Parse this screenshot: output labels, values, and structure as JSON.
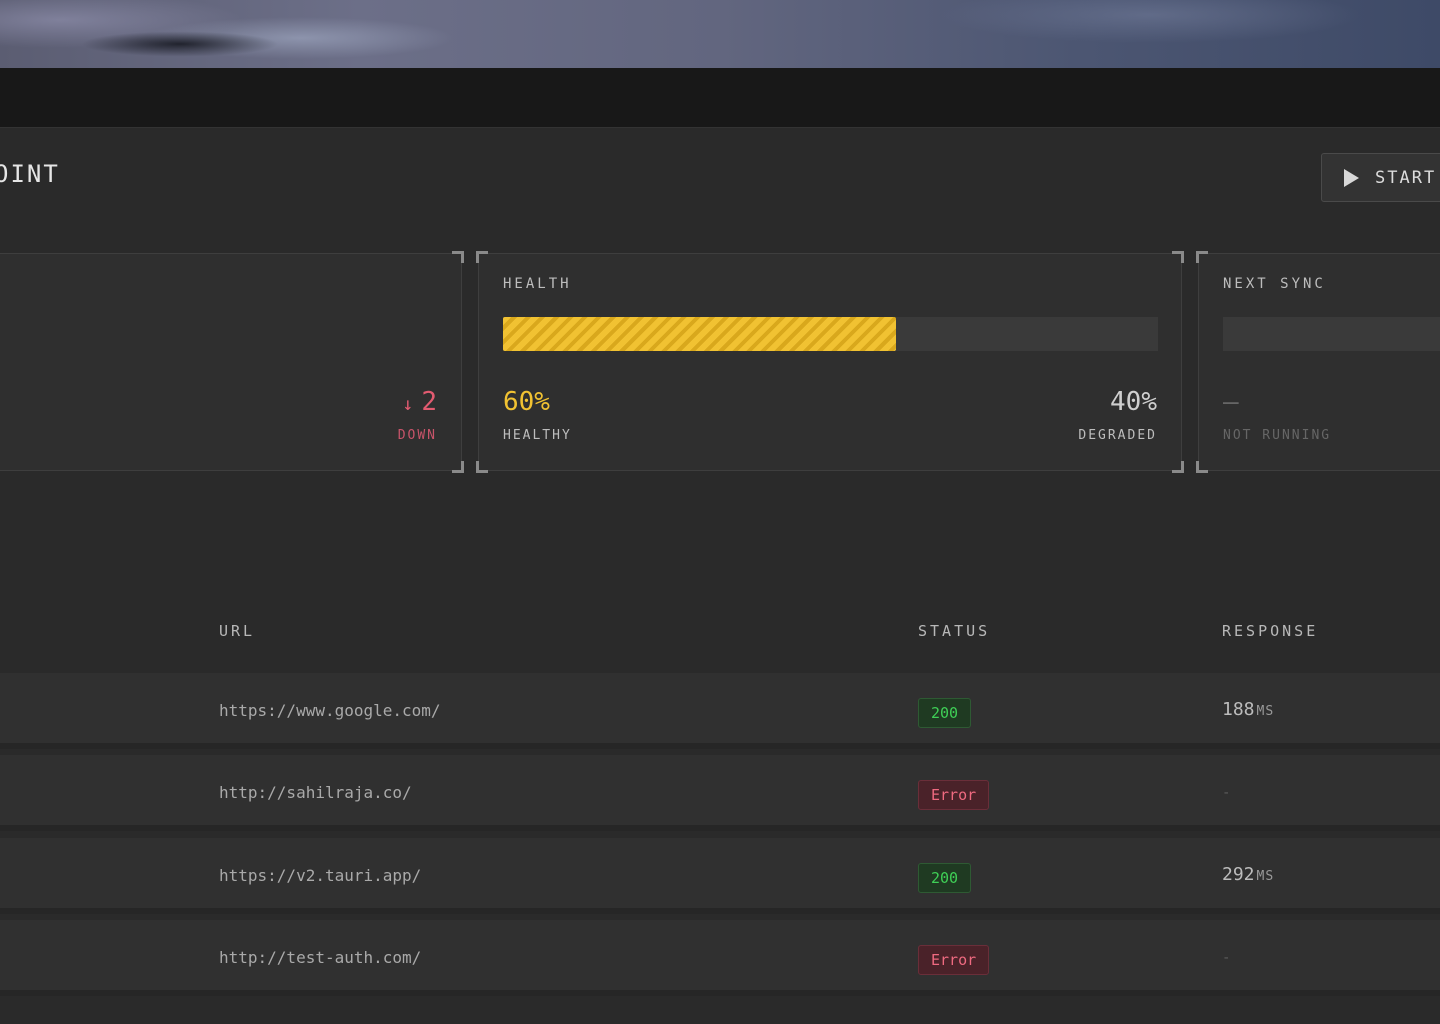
{
  "page": {
    "heading": "OINT"
  },
  "toolbar": {
    "start_label": "START"
  },
  "stats": {
    "down": {
      "value": "2",
      "arrow": "↓",
      "caption": "DOWN"
    },
    "health": {
      "label": "HEALTH",
      "healthy_fraction": 0.6,
      "healthy_value": "60%",
      "healthy_caption": "HEALTHY",
      "degraded_value": "40%",
      "degraded_caption": "DEGRADED",
      "fill_color": "#f1c232"
    },
    "next_sync": {
      "label": "NEXT SYNC",
      "value": "—",
      "caption": "NOT RUNNING"
    }
  },
  "table": {
    "headers": {
      "url": "URL",
      "status": "STATUS",
      "response": "RESPONSE"
    },
    "rows": [
      {
        "url": "https://www.google.com/",
        "status": "200",
        "status_kind": "ok",
        "response": "188",
        "unit": "MS"
      },
      {
        "url": "http://sahilraja.co/",
        "status": "Error",
        "status_kind": "err",
        "response": "-",
        "unit": ""
      },
      {
        "url": "https://v2.tauri.app/",
        "status": "200",
        "status_kind": "ok",
        "response": "292",
        "unit": "MS"
      },
      {
        "url": "http://test-auth.com/",
        "status": "Error",
        "status_kind": "err",
        "response": "-",
        "unit": ""
      }
    ]
  }
}
